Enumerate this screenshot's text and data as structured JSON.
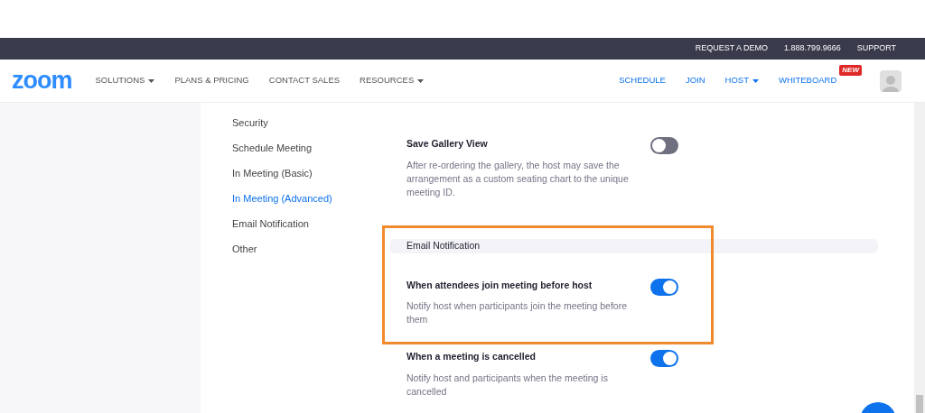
{
  "top_bar": {
    "links": [
      "REQUEST A DEMO",
      "1.888.799.9666",
      "SUPPORT"
    ]
  },
  "nav": {
    "logo": "zoom",
    "left": [
      {
        "label": "SOLUTIONS",
        "dropdown": true
      },
      {
        "label": "PLANS & PRICING",
        "dropdown": false
      },
      {
        "label": "CONTACT SALES",
        "dropdown": false
      },
      {
        "label": "RESOURCES",
        "dropdown": true
      }
    ],
    "right": [
      {
        "label": "SCHEDULE",
        "dropdown": false
      },
      {
        "label": "JOIN",
        "dropdown": false
      },
      {
        "label": "HOST",
        "dropdown": true
      },
      {
        "label": "WHITEBOARD",
        "dropdown": false,
        "badge": "NEW"
      }
    ]
  },
  "sidebar": {
    "items": [
      {
        "label": "Security",
        "selected": false
      },
      {
        "label": "Schedule Meeting",
        "selected": false
      },
      {
        "label": "In Meeting (Basic)",
        "selected": false
      },
      {
        "label": "In Meeting (Advanced)",
        "selected": true
      },
      {
        "label": "Email Notification",
        "selected": false
      },
      {
        "label": "Other",
        "selected": false
      }
    ]
  },
  "settings": [
    {
      "kind": "setting",
      "title": "Save Gallery View",
      "description": "After re-ordering the gallery, the host may save the arrangement as a custom seating chart to the unique meeting ID.",
      "on": false
    },
    {
      "kind": "section",
      "title": "Email Notification"
    },
    {
      "kind": "setting",
      "title": "When attendees join meeting before host",
      "description": "Notify host when participants join the meeting before them",
      "on": true
    },
    {
      "kind": "setting",
      "title": "When a meeting is cancelled",
      "description": "Notify host and participants when the meeting is cancelled",
      "on": true
    }
  ]
}
